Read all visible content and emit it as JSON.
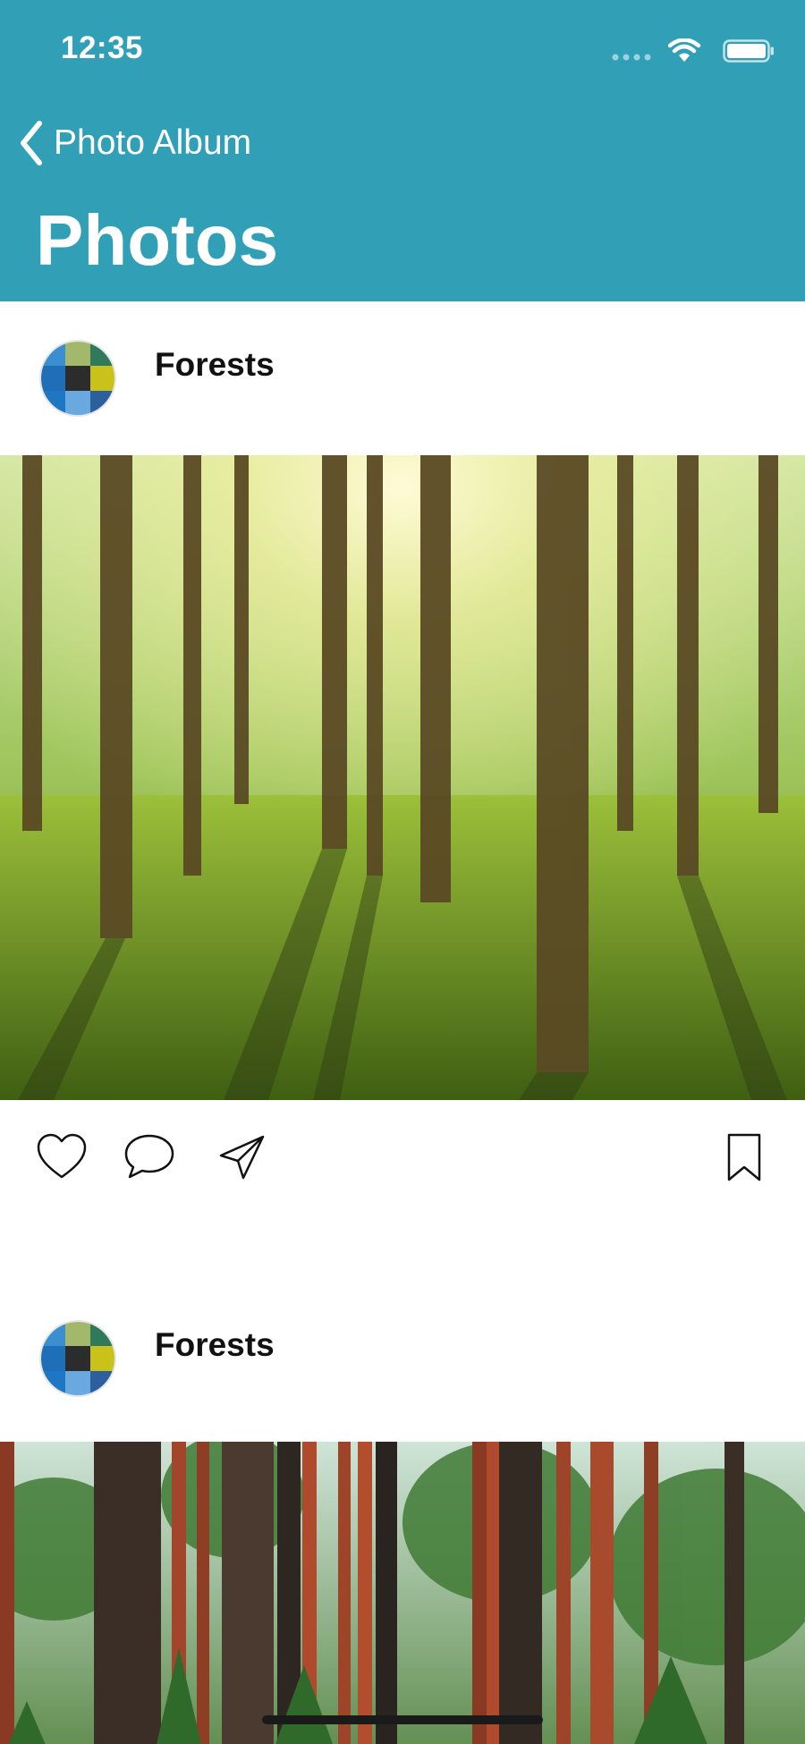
{
  "status_bar": {
    "time": "12:35",
    "icons": [
      "cellular-signal-icon",
      "wifi-icon",
      "battery-icon"
    ]
  },
  "nav": {
    "back_label": "Photo Album",
    "back_icon": "chevron-left-icon",
    "title": "Photos"
  },
  "posts": [
    {
      "author": "Forests",
      "photo_description": "sunlit forest",
      "actions": [
        "heart-icon",
        "comment-icon",
        "send-icon",
        "bookmark-icon"
      ]
    },
    {
      "author": "Forests",
      "photo_description": "pine forest"
    }
  ],
  "colors": {
    "header_bg": "#31a0b7",
    "header_text": "#ffffff",
    "body_bg": "#ffffff"
  }
}
